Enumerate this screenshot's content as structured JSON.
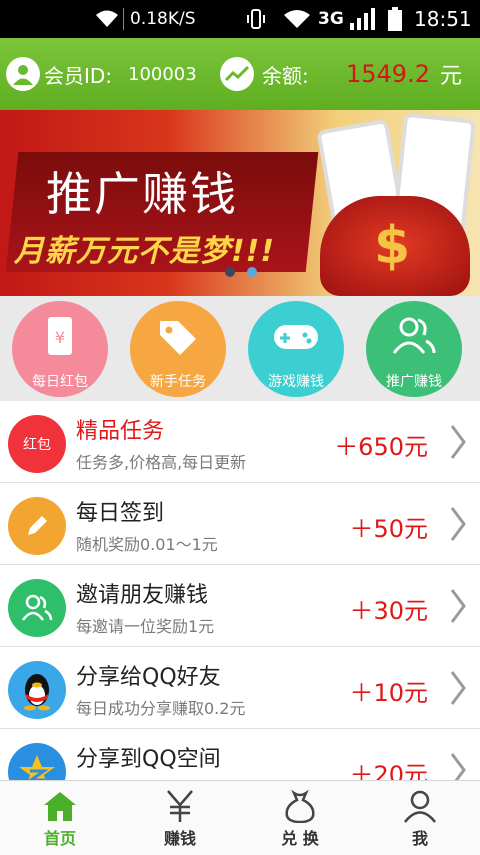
{
  "status_bar": {
    "net_speed": "0.18K/S",
    "network": "3G",
    "time": "18:51"
  },
  "account": {
    "member_id_label": "会员ID:",
    "member_id": "100003",
    "balance_label": "余额:",
    "balance": "1549.2",
    "currency": "元"
  },
  "banner": {
    "headline": "推广赚钱",
    "slogan": "月薪万元不是梦!!!"
  },
  "categories": [
    {
      "label": "每日红包",
      "color": "#f58a9b",
      "icon": "red-envelope-icon"
    },
    {
      "label": "新手任务",
      "color": "#f7a742",
      "icon": "tag-icon"
    },
    {
      "label": "游戏赚钱",
      "color": "#3ccfd2",
      "icon": "gamepad-icon"
    },
    {
      "label": "推广赚钱",
      "color": "#3cc077",
      "icon": "users-icon"
    }
  ],
  "tasks": [
    {
      "icon_text": "红包",
      "title": "精品任务",
      "subtitle": "任务多,价格高,每日更新",
      "reward": "＋650元",
      "color": "#f0323a",
      "title_color": "#e01818"
    },
    {
      "icon_text": "",
      "title": "每日签到",
      "subtitle": "随机奖励0.01～1元",
      "reward": "＋50元",
      "color": "#f2a530"
    },
    {
      "icon_text": "",
      "title": "邀请朋友赚钱",
      "subtitle": "每邀请一位奖励1元",
      "reward": "＋30元",
      "color": "#2fbf6b"
    },
    {
      "icon_text": "",
      "title": "分享给QQ好友",
      "subtitle": "每日成功分享赚取0.2元",
      "reward": "＋10元",
      "color": "#3aa8e8"
    },
    {
      "icon_text": "",
      "title": "分享到QQ空间",
      "subtitle": "",
      "reward": "＋20元",
      "color": "#2a8fe0"
    }
  ],
  "bottom_nav": [
    {
      "label": "首页",
      "icon": "home-icon",
      "active": true
    },
    {
      "label": "赚钱",
      "icon": "yen-icon",
      "active": false
    },
    {
      "label": "兑 换",
      "icon": "money-bag-icon",
      "active": false
    },
    {
      "label": "我",
      "icon": "person-icon",
      "active": false
    }
  ],
  "colors": {
    "header_green": "#6ab92c",
    "accent_red": "#e01818",
    "nav_active": "#4caf2a"
  }
}
